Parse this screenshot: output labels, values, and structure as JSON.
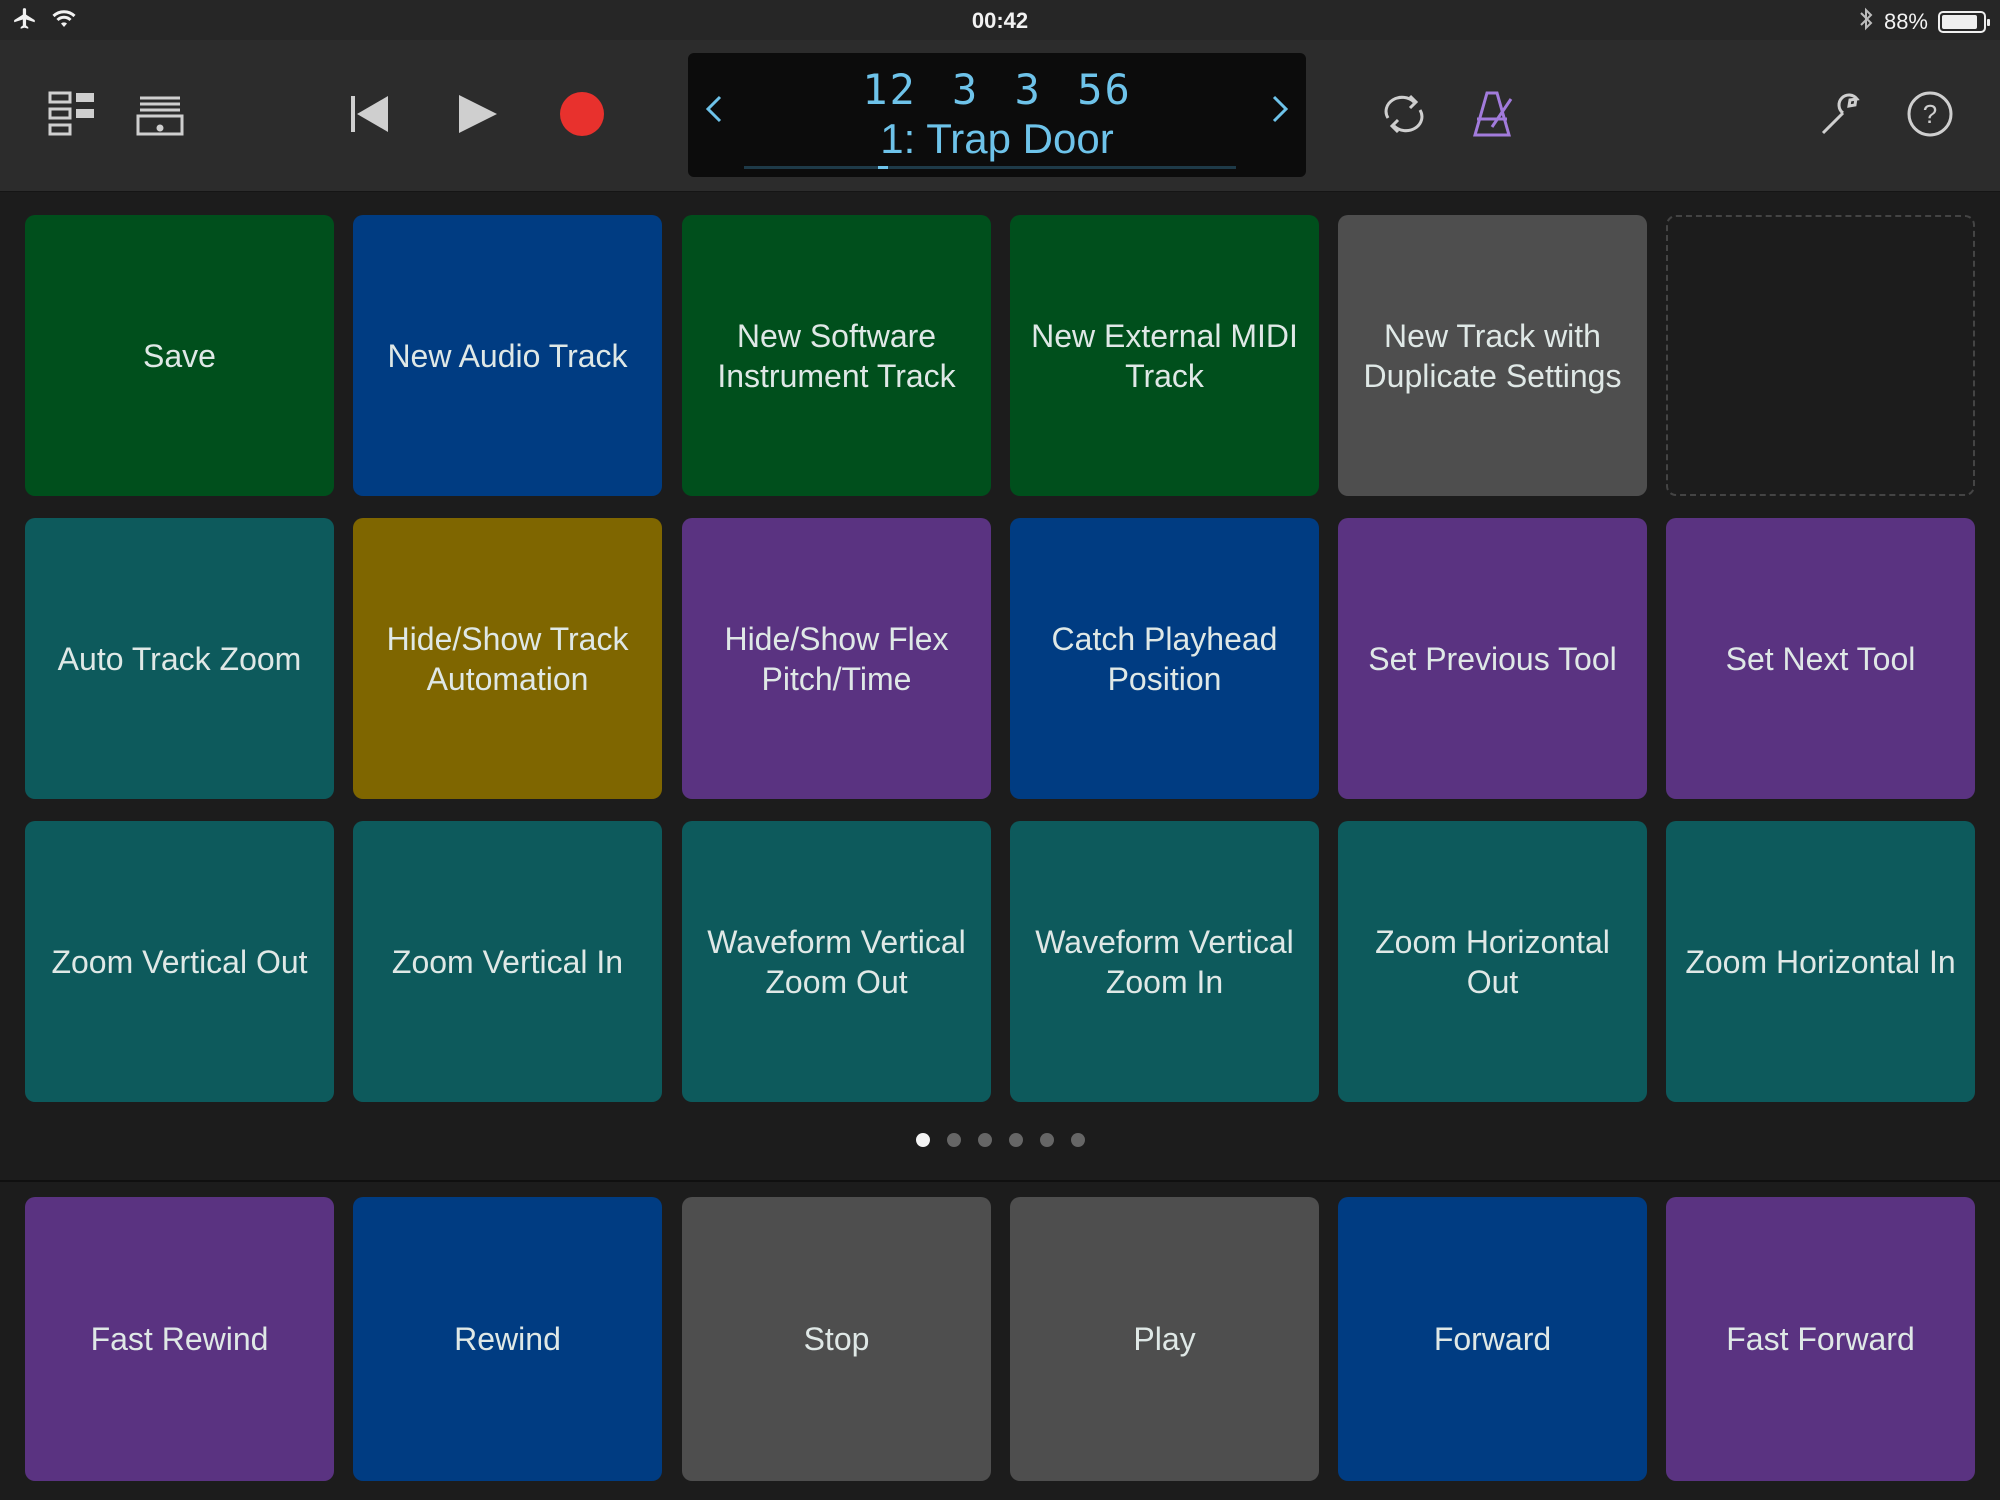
{
  "status_bar": {
    "time": "00:42",
    "battery_text": "88%",
    "battery_level": 0.88,
    "icons": [
      "airplane-icon",
      "wifi-icon",
      "bluetooth-icon",
      "battery-icon"
    ]
  },
  "control_bar": {
    "icons": [
      "mixer-view-icon",
      "library-icon",
      "go-to-beginning-icon",
      "play-icon",
      "record-icon",
      "cycle-icon",
      "metronome-icon",
      "settings-wrench-icon",
      "help-icon"
    ],
    "lcd": {
      "position": "12 3 3   56",
      "song_name": "1: Trap Door"
    },
    "colors": {
      "record": "#e8312d",
      "lcd_text": "#6ec3ea",
      "metronome": "#a27bdc"
    }
  },
  "page_dots": {
    "count": 6,
    "active": 0
  },
  "key_colors": {
    "green": "#004f1c",
    "blue": "#003c82",
    "gray": "#4e4e4e",
    "teal": "#0d5a5c",
    "gold": "#7f6600",
    "purple": "#5a3381"
  },
  "commands": [
    {
      "label": "Save",
      "color": "green"
    },
    {
      "label": "New Audio Track",
      "color": "blue"
    },
    {
      "label": "New Software Instrument Track",
      "color": "green"
    },
    {
      "label": "New External MIDI Track",
      "color": "green"
    },
    {
      "label": "New Track with Duplicate Settings",
      "color": "gray"
    },
    {
      "label": "",
      "color": "empty"
    },
    {
      "label": "Auto Track Zoom",
      "color": "teal"
    },
    {
      "label": "Hide/Show Track Automation",
      "color": "gold"
    },
    {
      "label": "Hide/Show Flex Pitch/Time",
      "color": "purple"
    },
    {
      "label": "Catch Playhead Position",
      "color": "blue"
    },
    {
      "label": "Set Previous Tool",
      "color": "purple"
    },
    {
      "label": "Set Next Tool",
      "color": "purple"
    },
    {
      "label": "Zoom Vertical Out",
      "color": "teal"
    },
    {
      "label": "Zoom Vertical In",
      "color": "teal"
    },
    {
      "label": "Waveform Vertical Zoom Out",
      "color": "teal"
    },
    {
      "label": "Waveform Vertical Zoom In",
      "color": "teal"
    },
    {
      "label": "Zoom Horizontal Out",
      "color": "teal"
    },
    {
      "label": "Zoom Horizontal In",
      "color": "teal"
    }
  ],
  "transport": [
    {
      "label": "Fast Rewind",
      "color": "purple"
    },
    {
      "label": "Rewind",
      "color": "blue"
    },
    {
      "label": "Stop",
      "color": "gray"
    },
    {
      "label": "Play",
      "color": "gray"
    },
    {
      "label": "Forward",
      "color": "blue"
    },
    {
      "label": "Fast Forward",
      "color": "purple"
    }
  ]
}
